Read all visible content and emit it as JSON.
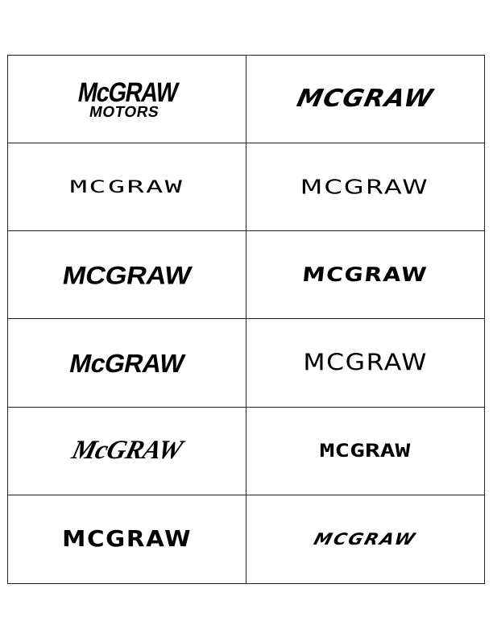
{
  "logos": [
    {
      "main": "McGRAW",
      "sub": "MOTORS"
    },
    {
      "text": "MCGRAW"
    },
    {
      "text": "MCGRAW"
    },
    {
      "text": "MCGRAW"
    },
    {
      "text": "MCGRAW"
    },
    {
      "text": "MCGRAW"
    },
    {
      "text": "McGRAW"
    },
    {
      "text": "MCGRAW"
    },
    {
      "text": "McGRAW"
    },
    {
      "text": "MCGRAW"
    },
    {
      "text": "MCGRAW"
    },
    {
      "text": "MCGRAW"
    }
  ]
}
